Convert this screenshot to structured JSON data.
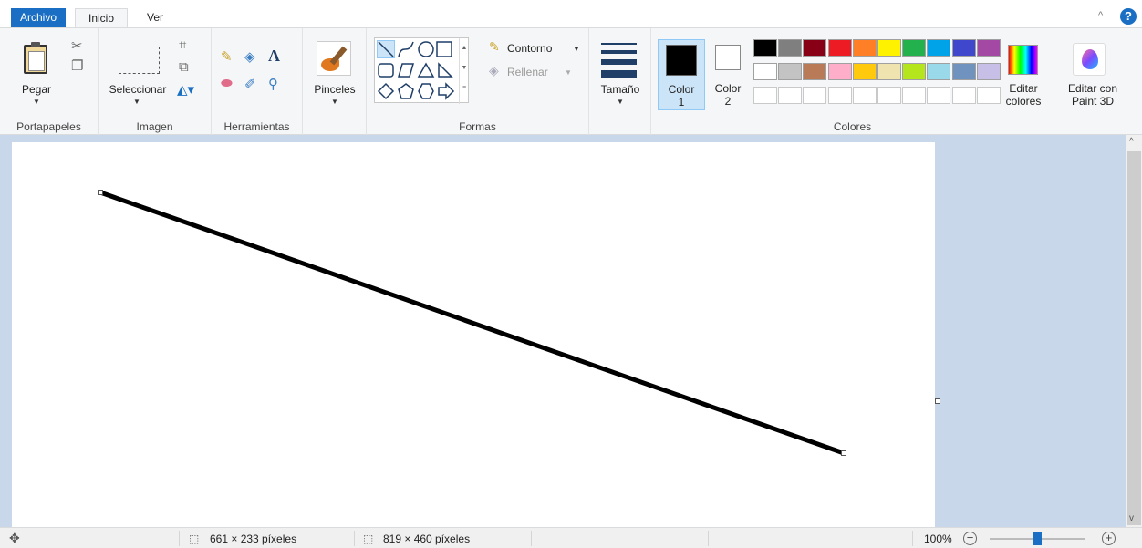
{
  "tabs": {
    "file": "Archivo",
    "home": "Inicio",
    "view": "Ver"
  },
  "help_glyph": "?",
  "ribbon": {
    "clipboard": {
      "paste": "Pegar",
      "group": "Portapapeles"
    },
    "image": {
      "select": "Seleccionar",
      "group": "Imagen"
    },
    "tools": {
      "group": "Herramientas"
    },
    "brushes": {
      "label": "Pinceles"
    },
    "shapes": {
      "outline": "Contorno",
      "fill": "Rellenar",
      "group": "Formas"
    },
    "size": {
      "label": "Tamaño"
    },
    "colors": {
      "color1": "Color",
      "color1_num": "1",
      "color2": "Color",
      "color2_num": "2",
      "edit_line1": "Editar",
      "edit_line2": "colores",
      "group": "Colores",
      "palette_row1": [
        "#000000",
        "#7f7f7f",
        "#880015",
        "#ed1c24",
        "#ff7f27",
        "#fff200",
        "#22b14c",
        "#00a2e8",
        "#3f48cc",
        "#a349a4"
      ],
      "palette_row2": [
        "#ffffff",
        "#c3c3c3",
        "#b97a57",
        "#ffaec9",
        "#ffc90e",
        "#efe4b0",
        "#b5e61d",
        "#99d9ea",
        "#7092be",
        "#c8bfe7"
      ]
    },
    "paint3d": {
      "line1": "Editar con",
      "line2": "Paint 3D"
    }
  },
  "status": {
    "selection": "661 × 233 píxeles",
    "canvas_size": "819 × 460 píxeles",
    "zoom": "100%"
  }
}
